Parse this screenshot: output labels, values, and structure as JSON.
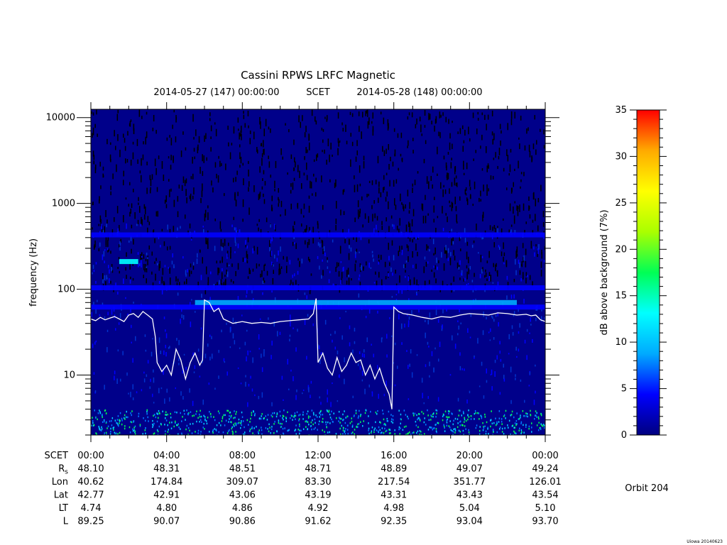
{
  "chart_data": {
    "type": "heatmap",
    "title": "Cassini RPWS LRFC Magnetic",
    "subtitle": {
      "start": "2014-05-27 (147) 00:00:00",
      "middle": "SCET",
      "end": "2014-05-28 (148) 00:00:00"
    },
    "ylabel": "frequency (Hz)",
    "yscale": "log",
    "ylim": [
      2,
      12500
    ],
    "ytick_labels": [
      "10000",
      "1000",
      "100",
      "10"
    ],
    "yticks": [
      10000,
      1000,
      100,
      10
    ],
    "xlim_hours": [
      0,
      24
    ],
    "x_ticks_hours": [
      0,
      4,
      8,
      12,
      16,
      20,
      24
    ],
    "colorbar": {
      "label": "dB above background (7%)",
      "range": [
        0,
        35
      ],
      "ticks": [
        0,
        5,
        10,
        15,
        20,
        25,
        30,
        35
      ],
      "tick_labels": [
        "0",
        "5",
        "10",
        "15",
        "20",
        "25",
        "30",
        "35"
      ],
      "colors": [
        "#00007f",
        "#0000ff",
        "#00aaff",
        "#00ffff",
        "#00ff55",
        "#aaff00",
        "#ffff00",
        "#ffaa00",
        "#ff0000"
      ]
    },
    "emission_bands_hz": [
      {
        "freq": 62,
        "level_db": 6,
        "start_h": 0,
        "end_h": 24
      },
      {
        "freq": 70,
        "level_db": 8,
        "start_h": 5.5,
        "end_h": 22.5
      },
      {
        "freq": 104,
        "level_db": 6,
        "start_h": 0,
        "end_h": 24
      },
      {
        "freq": 210,
        "level_db": 12,
        "start_h": 1.5,
        "end_h": 2.5
      },
      {
        "freq": 430,
        "level_db": 5,
        "start_h": 0,
        "end_h": 24
      }
    ],
    "overlay_line": {
      "name": "",
      "color": "#ffffff",
      "x_hours": [
        0,
        0.25,
        0.5,
        0.75,
        1.0,
        1.25,
        1.5,
        1.75,
        2.0,
        2.25,
        2.5,
        2.75,
        3.0,
        3.25,
        3.4,
        3.5,
        3.75,
        4.0,
        4.25,
        4.5,
        4.75,
        5.0,
        5.25,
        5.5,
        5.75,
        5.9,
        6.0,
        6.25,
        6.5,
        6.75,
        7.0,
        7.5,
        8.0,
        8.5,
        9.0,
        9.5,
        10.0,
        10.5,
        11.0,
        11.5,
        11.75,
        11.9,
        12.0,
        12.25,
        12.5,
        12.75,
        13.0,
        13.25,
        13.5,
        13.75,
        14.0,
        14.25,
        14.5,
        14.75,
        15.0,
        15.25,
        15.5,
        15.75,
        15.9,
        16.0,
        16.25,
        16.5,
        17.0,
        17.5,
        18.0,
        18.5,
        19.0,
        19.5,
        20.0,
        20.5,
        21.0,
        21.5,
        22.0,
        22.5,
        23.0,
        23.25,
        23.5,
        23.75,
        24.0
      ],
      "y_hz": [
        45,
        43,
        47,
        44,
        46,
        48,
        45,
        42,
        50,
        52,
        47,
        55,
        50,
        45,
        28,
        14,
        11,
        13,
        10,
        20,
        15,
        9,
        14,
        18,
        13,
        15,
        75,
        70,
        55,
        60,
        45,
        40,
        42,
        40,
        41,
        40,
        42,
        43,
        44,
        45,
        52,
        78,
        14,
        18,
        12,
        10,
        16,
        11,
        13,
        18,
        14,
        15,
        10,
        13,
        9,
        12,
        8,
        6,
        4,
        62,
        55,
        52,
        50,
        47,
        45,
        48,
        47,
        50,
        52,
        51,
        50,
        53,
        52,
        50,
        51,
        49,
        50,
        44,
        42
      ]
    }
  },
  "ephemeris": {
    "header": "SCET",
    "time_labels": [
      "00:00",
      "04:00",
      "08:00",
      "12:00",
      "16:00",
      "20:00",
      "00:00"
    ],
    "rows": [
      {
        "label": "R",
        "sub": "s",
        "values": [
          "48.10",
          "48.31",
          "48.51",
          "48.71",
          "48.89",
          "49.07",
          "49.24"
        ]
      },
      {
        "label": "Lon",
        "sub": "",
        "values": [
          "40.62",
          "174.84",
          "309.07",
          "83.30",
          "217.54",
          "351.77",
          "126.01"
        ]
      },
      {
        "label": "Lat",
        "sub": "",
        "values": [
          "42.77",
          "42.91",
          "43.06",
          "43.19",
          "43.31",
          "43.43",
          "43.54"
        ]
      },
      {
        "label": "LT",
        "sub": "",
        "values": [
          "4.74",
          "4.80",
          "4.86",
          "4.92",
          "4.98",
          "5.04",
          "5.10"
        ]
      },
      {
        "label": "L",
        "sub": "",
        "values": [
          "89.25",
          "90.07",
          "90.86",
          "91.62",
          "92.35",
          "93.04",
          "93.70"
        ]
      }
    ]
  },
  "orbit_label": "Orbit 204",
  "footer_stamp": "Uiowa 20140623"
}
